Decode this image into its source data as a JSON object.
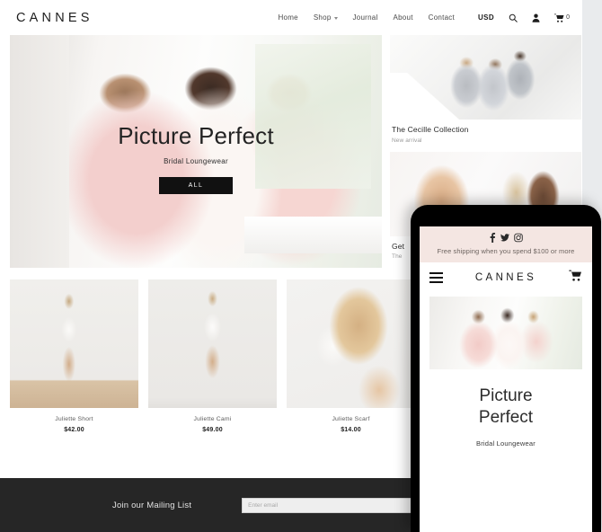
{
  "desktop": {
    "brand": "CANNES",
    "nav": [
      {
        "label": "Home",
        "has_caret": false
      },
      {
        "label": "Shop",
        "has_caret": true
      },
      {
        "label": "Journal",
        "has_caret": false
      },
      {
        "label": "About",
        "has_caret": false
      },
      {
        "label": "Contact",
        "has_caret": false
      }
    ],
    "utils": {
      "currency": "USD",
      "search_icon": "search-icon",
      "account_icon": "user-icon",
      "cart_icon": "cart-icon",
      "cart_count": "0"
    },
    "hero": {
      "title": "Picture Perfect",
      "subtitle": "Bridal Loungewear",
      "button": "ALL"
    },
    "side_cards": [
      {
        "title": "The Cecille Collection",
        "subtitle": "New arrival"
      },
      {
        "title": "Get",
        "subtitle": "The"
      }
    ],
    "products": [
      {
        "name": "Juliette Short",
        "price": "$42.00"
      },
      {
        "name": "Juliette Cami",
        "price": "$49.00"
      },
      {
        "name": "Juliette Scarf",
        "price": "$14.00"
      }
    ],
    "newsletter": {
      "heading": "Join our Mailing List",
      "placeholder": "Enter email",
      "value": ""
    }
  },
  "mobile": {
    "announce": {
      "social": [
        "facebook-icon",
        "twitter-icon",
        "instagram-icon"
      ],
      "shipping": "Free shipping when you spend $100 or more"
    },
    "header": {
      "menu_icon": "hamburger-menu-icon",
      "brand": "CANNES",
      "cart_icon": "cart-icon"
    },
    "hero": {
      "title_line1": "Picture",
      "title_line2": "Perfect",
      "subtitle": "Bridal Loungewear"
    }
  },
  "colors": {
    "accent_pink": "#f4e6e2",
    "footer_dark": "#262626",
    "page_bg": "#e9ebed",
    "button_black": "#111111"
  }
}
